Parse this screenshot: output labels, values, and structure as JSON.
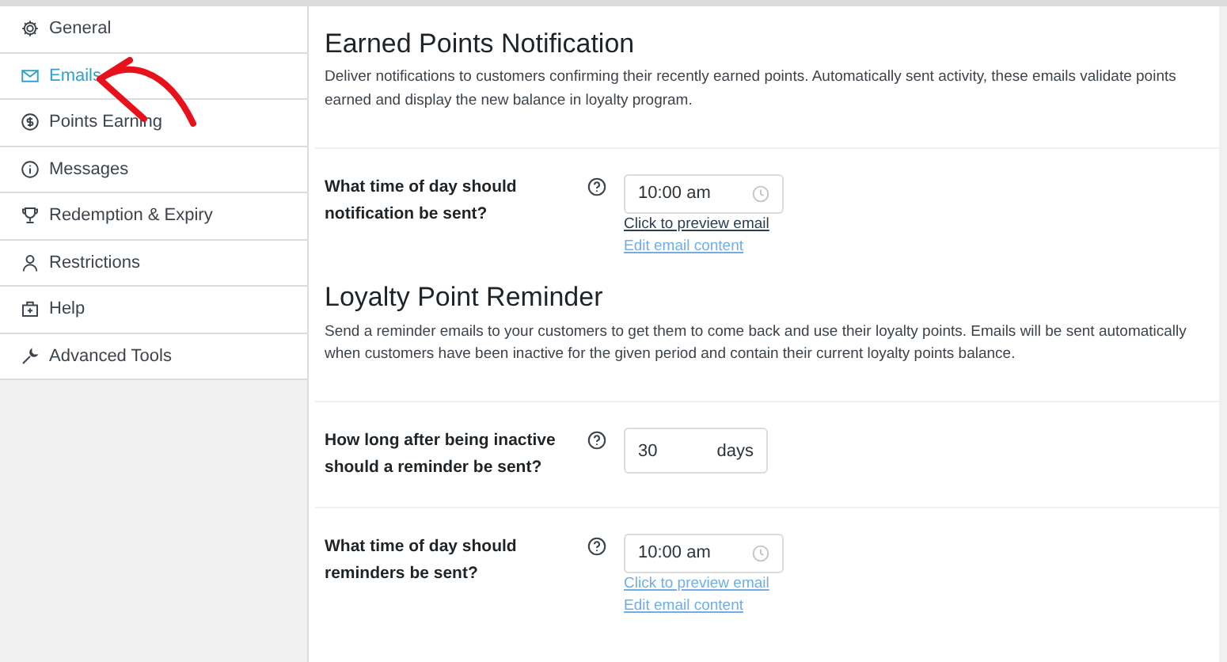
{
  "sidebar": {
    "items": [
      {
        "label": "General",
        "selected": false
      },
      {
        "label": "Emails",
        "selected": true
      },
      {
        "label": "Points Earning",
        "selected": false
      },
      {
        "label": "Messages",
        "selected": false
      },
      {
        "label": "Redemption & Expiry",
        "selected": false
      },
      {
        "label": "Restrictions",
        "selected": false
      },
      {
        "label": "Help",
        "selected": false
      },
      {
        "label": "Advanced Tools",
        "selected": false
      }
    ]
  },
  "sections": [
    {
      "title": "Earned Points Notification",
      "description": "Deliver notifications to customers confirming their recently earned points. Automatically sent activity, these emails validate points earned and display the new balance in loyalty program.",
      "settings": [
        {
          "kind": "time",
          "label": "What time of day should notification be sent?",
          "value": "10:00 am",
          "links": [
            {
              "text": "Click to preview email",
              "visited": true
            },
            {
              "text": "Edit email content",
              "visited": false
            }
          ]
        }
      ]
    },
    {
      "title": "Loyalty Point Reminder",
      "description": "Send a reminder emails to your customers to get them to come back and use their loyalty points. Emails will be sent automatically when customers have been inactive for the given period and contain their current loyalty points balance.",
      "settings": [
        {
          "kind": "days",
          "label": "How long after being inactive should a reminder be sent?",
          "value": "30",
          "unit": "days"
        },
        {
          "kind": "time",
          "label": "What time of day should reminders be sent?",
          "value": "10:00 am",
          "links": [
            {
              "text": "Click to preview email"
            },
            {
              "text": "Edit email content"
            }
          ]
        }
      ]
    }
  ]
}
